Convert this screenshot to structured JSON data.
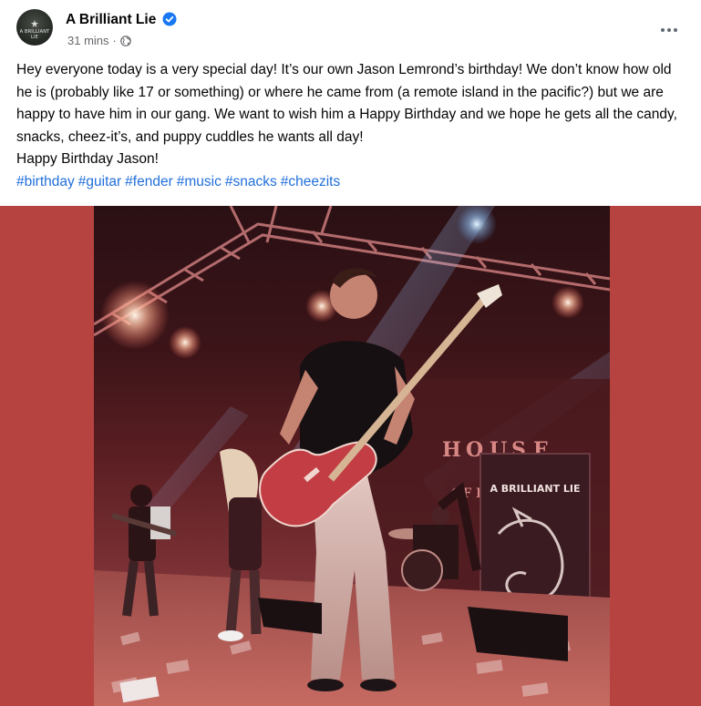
{
  "post": {
    "page_name": "A Brilliant Lie",
    "avatar_text": "A BRILLIANT LIE",
    "time": "31 mins",
    "separator": "·",
    "privacy_icon": "globe-icon",
    "verified_icon": "verified-badge-icon",
    "more_icon": "more-horizontal-icon",
    "body_lines": [
      "Hey everyone today is a very special day! It’s our own Jason Lemrond’s birthday! We don’t know how old he is (probably like 17 or something) or where he came from (a remote island in the pacific?) but we are happy to have him in our gang. We want to wish him a Happy Birthday and we hope he gets all the candy, snacks, cheez-it’s, and puppy cuddles he wants all day!",
      "Happy Birthday Jason!"
    ],
    "hashtags": [
      "#birthday",
      "#guitar",
      "#fender",
      "#music",
      "#snacks",
      "#cheezits"
    ],
    "photo": {
      "banner_text": "A BRILLIANT LIE",
      "venue_letters": [
        "H",
        "O",
        "U",
        "S",
        "E"
      ],
      "venue_small": "OF B"
    }
  },
  "colors": {
    "link": "#216fdb",
    "secondary_text": "#65676b",
    "media_background": "#b6433f",
    "verified": "#1877f2"
  }
}
